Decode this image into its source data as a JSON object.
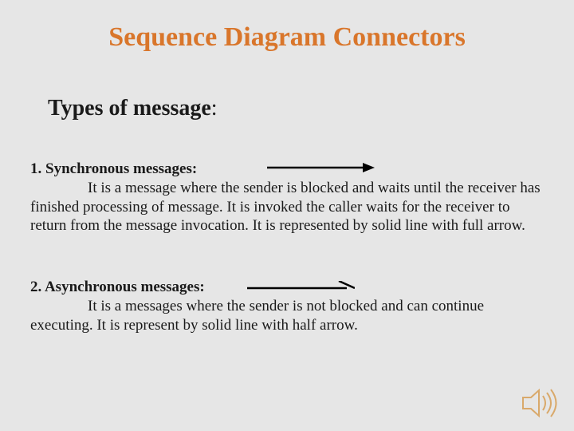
{
  "title": "Sequence Diagram Connectors",
  "subtitle_strong": "Types of message",
  "subtitle_suffix": ":",
  "item1": {
    "head": "1.  Synchronous messages:",
    "body": "It is a message where the sender is blocked and waits until the receiver has finished processing of message. It is invoked the caller waits for the receiver to return from the message invocation. It is represented by solid line with full arrow."
  },
  "item2": {
    "head": "2. Asynchronous messages:",
    "body": "It is a messages where the sender is not blocked and can continue executing.  It is represent by solid line with half arrow."
  }
}
